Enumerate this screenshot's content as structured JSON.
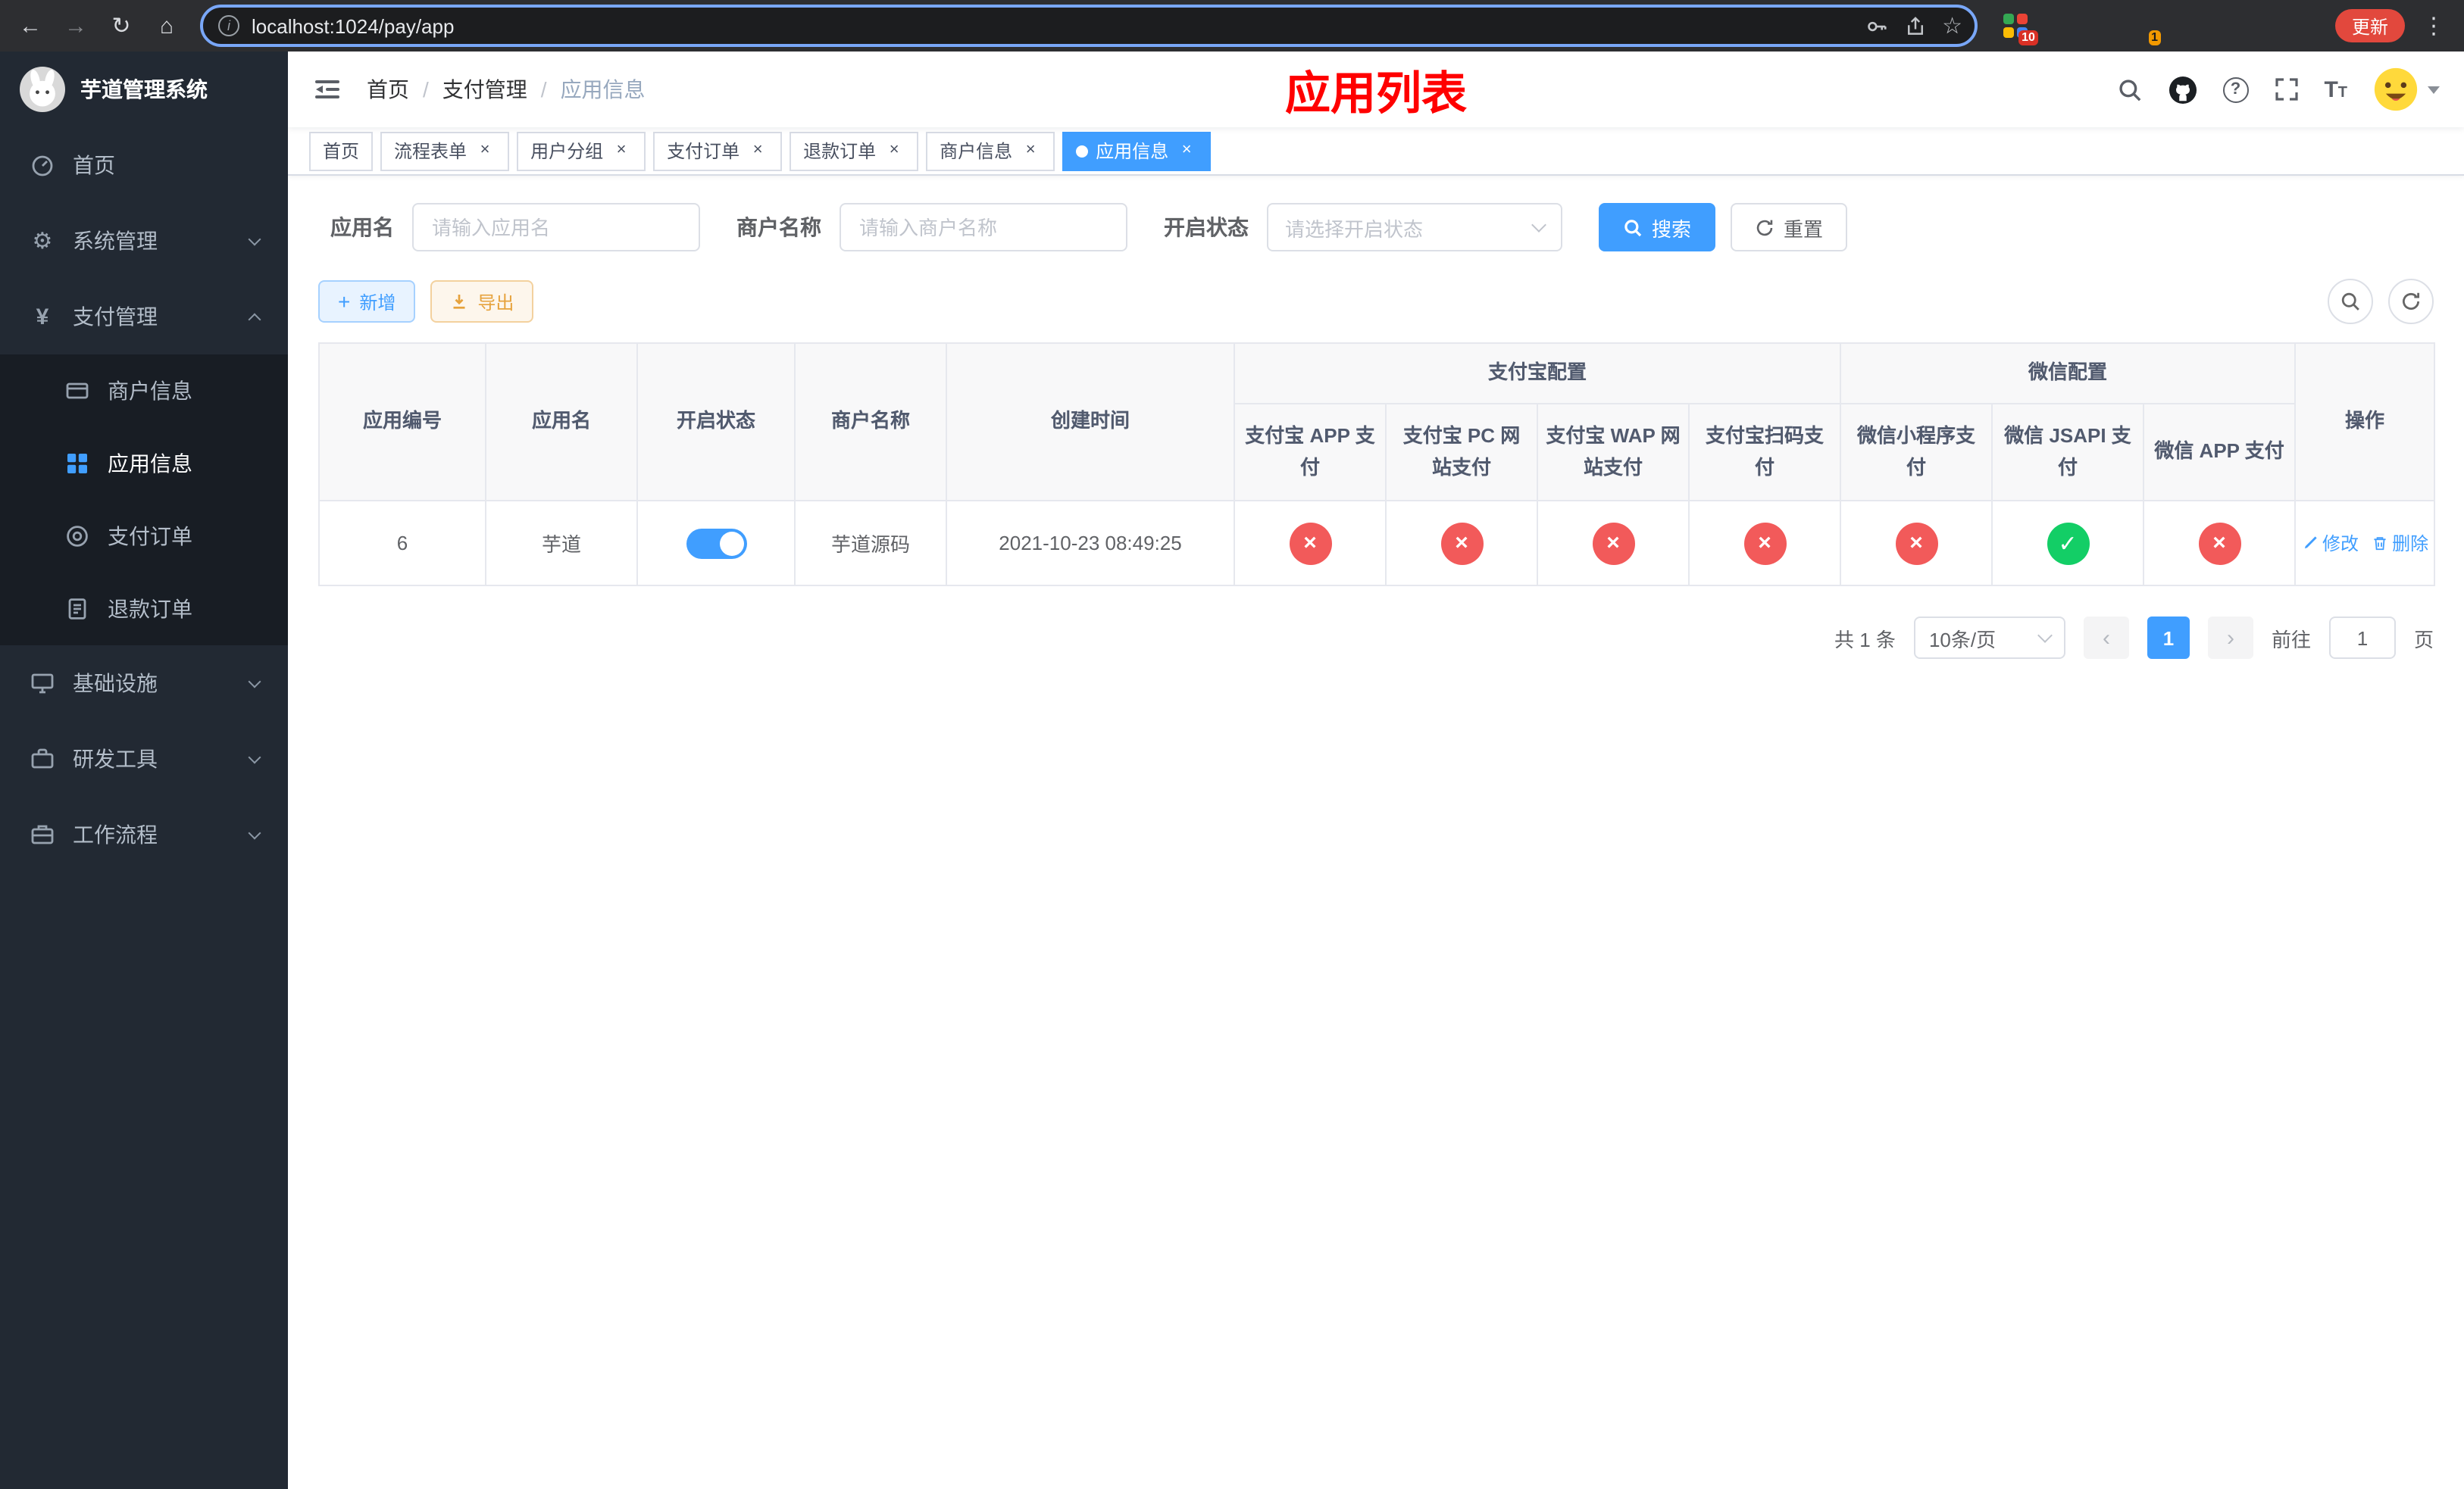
{
  "browser": {
    "url": "localhost:1024/pay/app",
    "update_button": "更新",
    "extension_badges": [
      "10",
      "1"
    ]
  },
  "sidebar": {
    "app_title": "芋道管理系统",
    "items": [
      {
        "label": "首页",
        "icon": "dashboard-icon"
      },
      {
        "label": "系统管理",
        "icon": "gear-icon",
        "state": "collapsed"
      },
      {
        "label": "支付管理",
        "icon": "yen-icon",
        "state": "expanded",
        "children": [
          {
            "label": "商户信息",
            "icon": "merchant-card-icon"
          },
          {
            "label": "应用信息",
            "icon": "app-grid-icon",
            "active": true
          },
          {
            "label": "支付订单",
            "icon": "pay-order-icon"
          },
          {
            "label": "退款订单",
            "icon": "refund-order-icon"
          }
        ]
      },
      {
        "label": "基础设施",
        "icon": "infrastructure-icon",
        "state": "collapsed"
      },
      {
        "label": "研发工具",
        "icon": "dev-tools-icon",
        "state": "collapsed"
      },
      {
        "label": "工作流程",
        "icon": "workflow-icon",
        "state": "collapsed"
      }
    ]
  },
  "header": {
    "breadcrumb": [
      "首页",
      "支付管理",
      "应用信息"
    ],
    "overlay_title": "应用列表"
  },
  "tabs": [
    {
      "label": "首页",
      "closable": false,
      "active": false
    },
    {
      "label": "流程表单",
      "closable": true,
      "active": false
    },
    {
      "label": "用户分组",
      "closable": true,
      "active": false
    },
    {
      "label": "支付订单",
      "closable": true,
      "active": false
    },
    {
      "label": "退款订单",
      "closable": true,
      "active": false
    },
    {
      "label": "商户信息",
      "closable": true,
      "active": false
    },
    {
      "label": "应用信息",
      "closable": true,
      "active": true
    }
  ],
  "filters": {
    "app_name": {
      "label": "应用名",
      "placeholder": "请输入应用名"
    },
    "merchant_name": {
      "label": "商户名称",
      "placeholder": "请输入商户名称"
    },
    "status": {
      "label": "开启状态",
      "placeholder": "请选择开启状态"
    },
    "search_button": "搜索",
    "reset_button": "重置"
  },
  "toolbar": {
    "add_button": "新增",
    "export_button": "导出"
  },
  "table": {
    "columns": {
      "app_id": "应用编号",
      "app_name": "应用名",
      "status": "开启状态",
      "merchant_name": "商户名称",
      "create_time": "创建时间",
      "alipay_group": "支付宝配置",
      "alipay_cols": [
        "支付宝 APP 支付",
        "支付宝 PC 网站支付",
        "支付宝 WAP 网站支付",
        "支付宝扫码支付"
      ],
      "wechat_group": "微信配置",
      "wechat_cols": [
        "微信小程序支付",
        "微信 JSAPI 支付",
        "微信 APP 支付"
      ],
      "actions": "操作"
    },
    "rows": [
      {
        "app_id": "6",
        "app_name": "芋道",
        "enabled": true,
        "merchant_name": "芋道源码",
        "create_time": "2021-10-23 08:49:25",
        "pay_channels": [
          "disabled",
          "disabled",
          "disabled",
          "disabled",
          "disabled",
          "enabled",
          "disabled"
        ],
        "edit_label": "修改",
        "delete_label": "删除"
      }
    ]
  },
  "pagination": {
    "total_text": "共 1 条",
    "page_size": "10条/页",
    "current_page": "1",
    "goto_prefix": "前往",
    "goto_value": "1",
    "goto_suffix": "页"
  }
}
